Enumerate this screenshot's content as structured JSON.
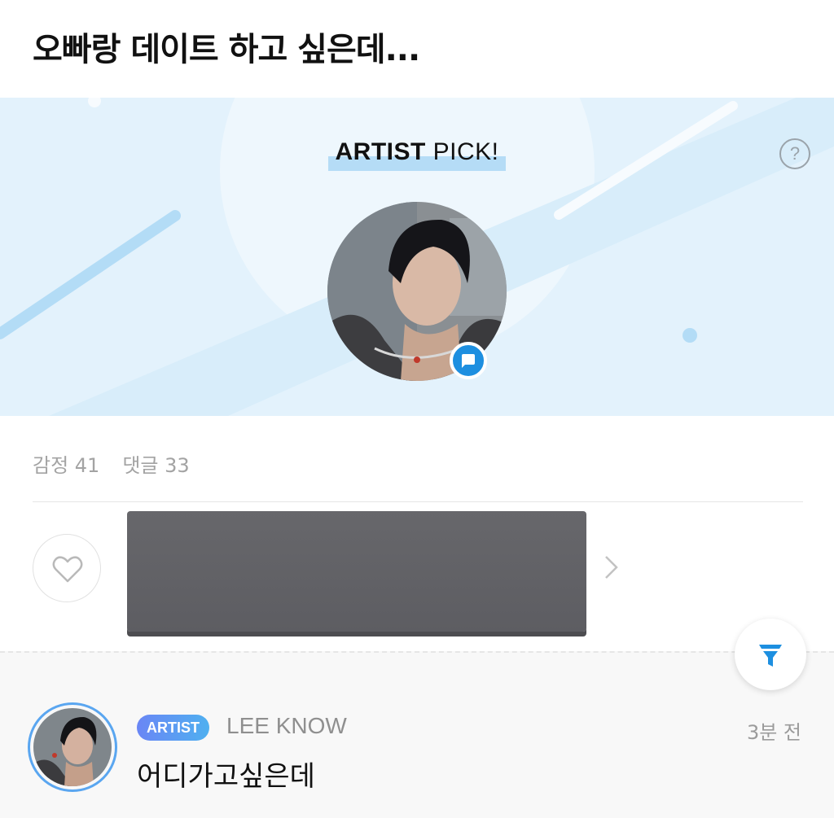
{
  "post": {
    "title": "오빠랑 데이트 하고 싶은데..."
  },
  "banner": {
    "pick_bold": "ARTIST",
    "pick_rest": " PICK!",
    "help_label": "?",
    "colors": {
      "background": "#e3f2fc",
      "highlight": "#b5dcf6",
      "badge": "#1d8fe0"
    },
    "icons": [
      "question-mark-icon",
      "chat-bubble-icon"
    ]
  },
  "stats": {
    "emotion": "감정 41",
    "comments": "댓글 33"
  },
  "actions": {
    "icons": [
      "heart-icon",
      "chevron-right-icon",
      "filter-icon"
    ],
    "accent": "#1d8fe0"
  },
  "comment": {
    "badge": "ARTIST",
    "author": "LEE KNOW",
    "time": "3분 전",
    "text": "어디가고싶은데"
  }
}
